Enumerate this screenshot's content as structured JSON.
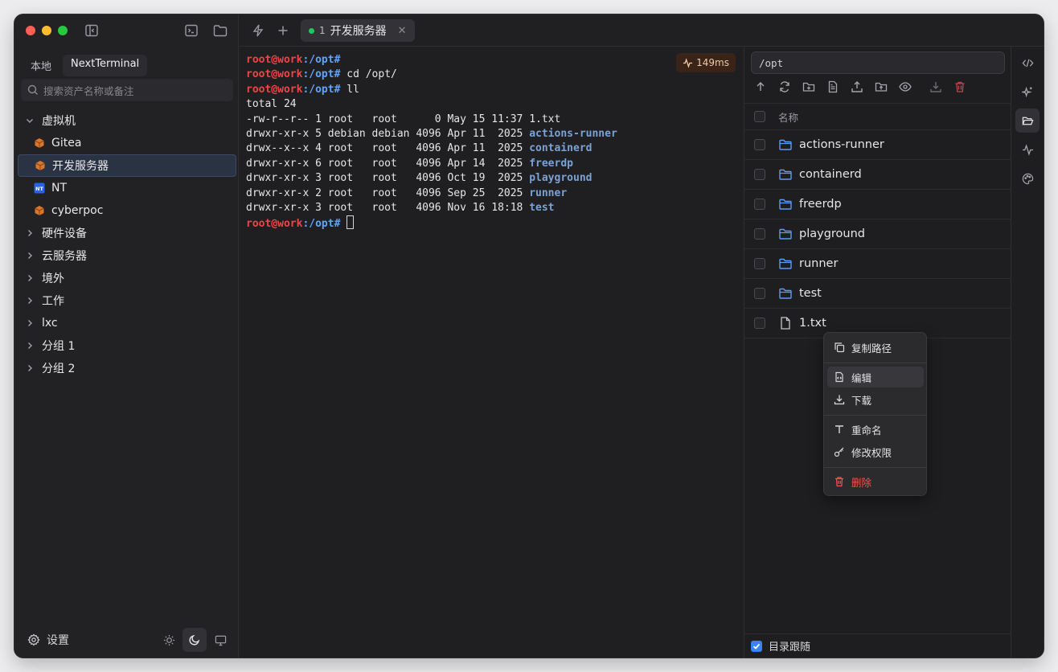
{
  "sidebar": {
    "tabs": [
      "本地",
      "NextTerminal"
    ],
    "search_placeholder": "搜索资产名称或备注",
    "groups": [
      {
        "label": "虚拟机",
        "expanded": true
      },
      {
        "label": "硬件设备"
      },
      {
        "label": "云服务器"
      },
      {
        "label": "境外"
      },
      {
        "label": "工作"
      },
      {
        "label": "lxc"
      },
      {
        "label": "分组 1"
      },
      {
        "label": "分组 2"
      }
    ],
    "vm_items": [
      {
        "label": "Gitea",
        "icon": "cube-icon"
      },
      {
        "label": "开发服务器",
        "icon": "cube-icon",
        "selected": true
      },
      {
        "label": "NT",
        "icon": "nt-badge-icon"
      },
      {
        "label": "cyberpoc",
        "icon": "cube-icon"
      }
    ],
    "settings_label": "设置"
  },
  "tab": {
    "index": "1",
    "title": "开发服务器",
    "status_color": "#22c55e"
  },
  "terminal": {
    "latency": "149ms",
    "prompt_user": "root@work",
    "prompt_path": ":/opt",
    "prompt_sym": "#",
    "lines": [
      {
        "type": "prompt",
        "cmd": ""
      },
      {
        "type": "prompt",
        "cmd": " cd /opt/"
      },
      {
        "type": "prompt",
        "cmd": " ll"
      },
      {
        "type": "text",
        "text": "total 24"
      },
      {
        "type": "ls",
        "meta": "-rw-r--r-- 1 root   root      0 May 15 11:37 ",
        "name": "1.txt",
        "isdir": false
      },
      {
        "type": "ls",
        "meta": "drwxr-xr-x 5 debian debian 4096 Apr 11  2025 ",
        "name": "actions-runner",
        "isdir": true
      },
      {
        "type": "ls",
        "meta": "drwx--x--x 4 root   root   4096 Apr 11  2025 ",
        "name": "containerd",
        "isdir": true
      },
      {
        "type": "ls",
        "meta": "drwxr-xr-x 6 root   root   4096 Apr 14  2025 ",
        "name": "freerdp",
        "isdir": true
      },
      {
        "type": "ls",
        "meta": "drwxr-xr-x 3 root   root   4096 Oct 19  2025 ",
        "name": "playground",
        "isdir": true
      },
      {
        "type": "ls",
        "meta": "drwxr-xr-x 2 root   root   4096 Sep 25  2025 ",
        "name": "runner",
        "isdir": true
      },
      {
        "type": "ls",
        "meta": "drwxr-xr-x 3 root   root   4096 Nov 16 18:18 ",
        "name": "test",
        "isdir": true
      },
      {
        "type": "prompt",
        "cmd": " ",
        "cursor": true
      }
    ]
  },
  "files": {
    "path": "/opt",
    "column_name": "名称",
    "items": [
      {
        "name": "actions-runner",
        "type": "folder"
      },
      {
        "name": "containerd",
        "type": "folder"
      },
      {
        "name": "freerdp",
        "type": "folder"
      },
      {
        "name": "playground",
        "type": "folder"
      },
      {
        "name": "runner",
        "type": "folder"
      },
      {
        "name": "test",
        "type": "folder"
      },
      {
        "name": "1.txt",
        "type": "file"
      }
    ],
    "follow_dir_label": "目录跟随",
    "follow_dir_checked": true
  },
  "context_menu": {
    "copy_path": "复制路径",
    "edit": "编辑",
    "download": "下载",
    "rename": "重命名",
    "chmod": "修改权限",
    "delete": "删除"
  }
}
